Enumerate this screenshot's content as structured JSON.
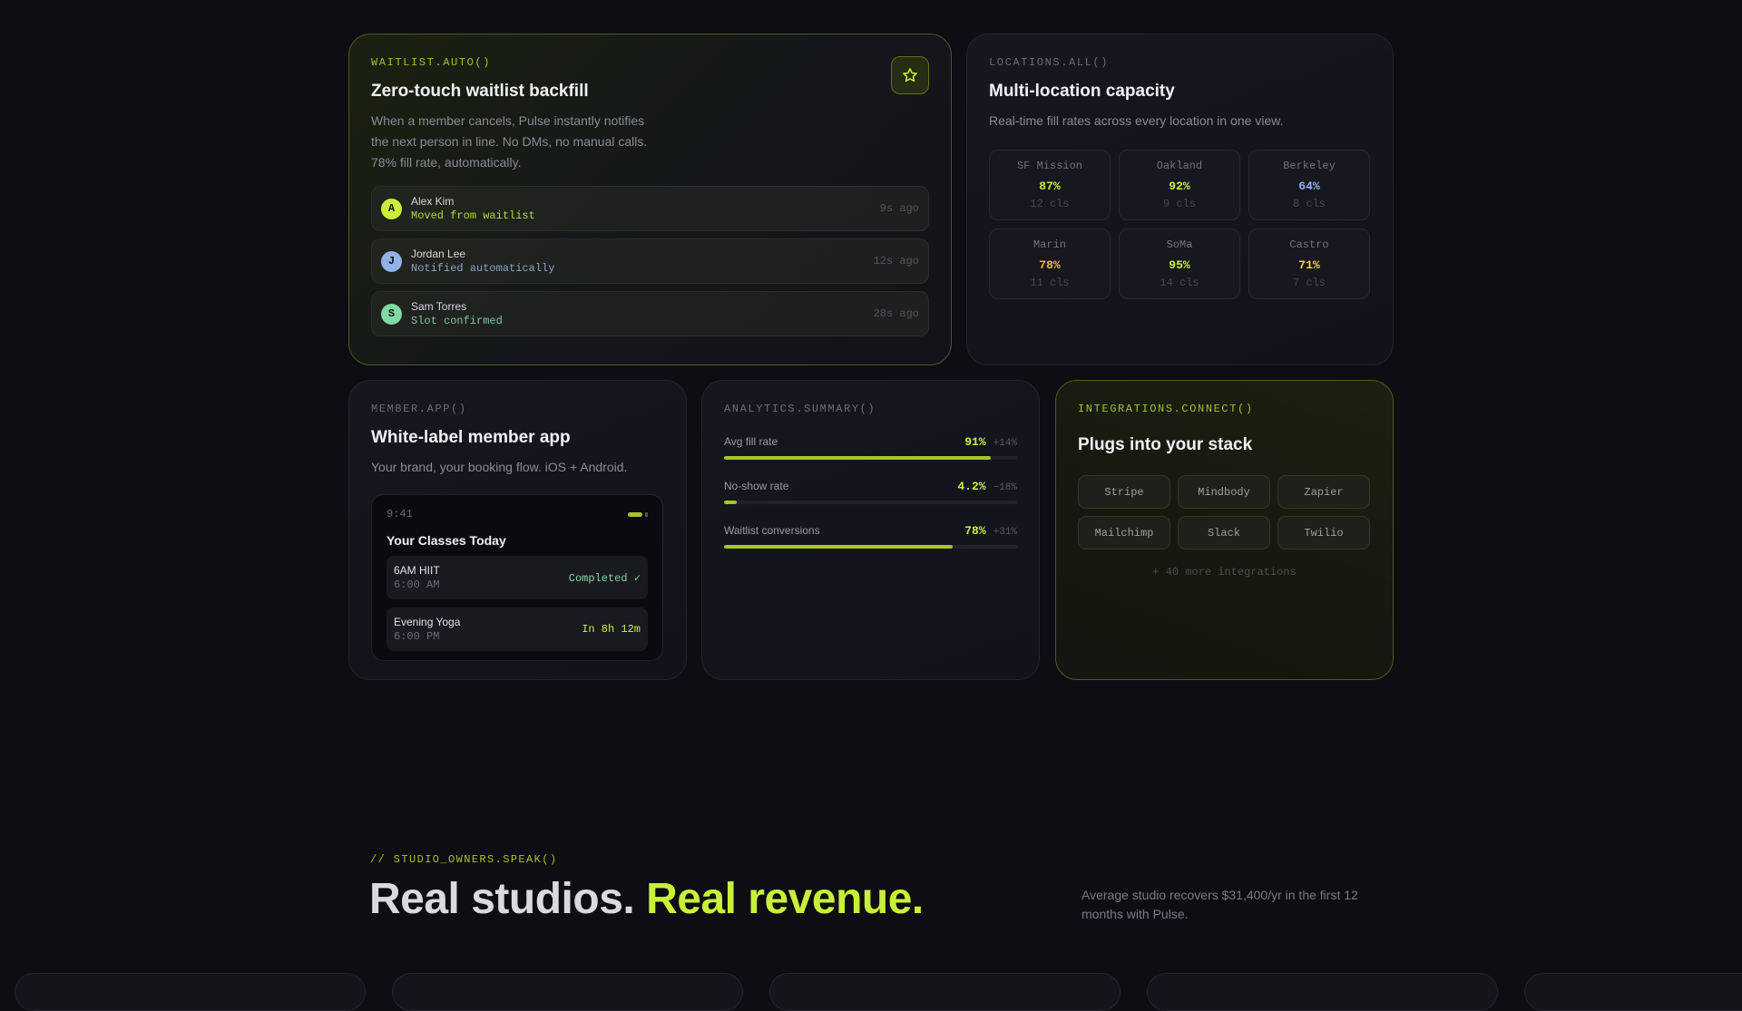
{
  "waitlist": {
    "tag": "WAITLIST.AUTO()",
    "title": "Zero-touch waitlist backfill",
    "desc": "When a member cancels, Pulse instantly notifies the next person in line. No DMs, no manual calls. 78% fill rate, automatically.",
    "star_icon": "star-icon",
    "rows": [
      {
        "initial": "A",
        "name": "Alex Kim",
        "status": "Moved from waitlist",
        "time": "9s ago",
        "avatar_color": "#c8f03a",
        "status_color": "#b5d936"
      },
      {
        "initial": "J",
        "name": "Jordan Lee",
        "status": "Notified automatically",
        "time": "12s ago",
        "avatar_color": "#8fb3e6",
        "status_color": "#8aa4c4"
      },
      {
        "initial": "S",
        "name": "Sam Torres",
        "status": "Slot confirmed",
        "time": "28s ago",
        "avatar_color": "#7fd9a3",
        "status_color": "#7fc79a"
      }
    ]
  },
  "locations": {
    "tag": "LOCATIONS.ALL()",
    "title": "Multi-location capacity",
    "desc": "Real-time fill rates across every location in one view.",
    "cells": [
      {
        "name": "SF Mission",
        "pct": "87%",
        "cls": "12 cls",
        "color": "#c8f03a"
      },
      {
        "name": "Oakland",
        "pct": "92%",
        "cls": "9 cls",
        "color": "#c8f03a"
      },
      {
        "name": "Berkeley",
        "pct": "64%",
        "cls": "8 cls",
        "color": "#8fb3f0"
      },
      {
        "name": "Marin",
        "pct": "78%",
        "cls": "11 cls",
        "color": "#f2b544"
      },
      {
        "name": "SoMa",
        "pct": "95%",
        "cls": "14 cls",
        "color": "#c8f03a"
      },
      {
        "name": "Castro",
        "pct": "71%",
        "cls": "7 cls",
        "color": "#f2d544"
      }
    ]
  },
  "member_app": {
    "tag": "MEMBER.APP()",
    "title": "White-label member app",
    "desc": "Your brand, your booking flow. iOS + Android.",
    "phone": {
      "time": "9:41",
      "title": "Your Classes Today",
      "classes": [
        {
          "name": "6AM HIIT",
          "time": "6:00 AM",
          "status": "Completed ✓",
          "status_color": "#7fd9a3"
        },
        {
          "name": "Evening Yoga",
          "time": "6:00 PM",
          "status": "In 8h 12m",
          "status_color": "#c8f03a"
        }
      ]
    }
  },
  "analytics": {
    "tag": "ANALYTICS.SUMMARY()",
    "metrics": [
      {
        "label": "Avg fill rate",
        "value": "91%",
        "delta": "+14%",
        "fill": 0.91
      },
      {
        "label": "No-show rate",
        "value": "4.2%",
        "delta": "−18%",
        "fill": 0.042
      },
      {
        "label": "Waitlist conversions",
        "value": "78%",
        "delta": "+31%",
        "fill": 0.78
      }
    ]
  },
  "integrations": {
    "tag": "INTEGRATIONS.CONNECT()",
    "title": "Plugs into your stack",
    "items": [
      "Stripe",
      "Mindbody",
      "Zapier",
      "Mailchimp",
      "Slack",
      "Twilio"
    ],
    "more": "+ 40 more integrations"
  },
  "testimonials": {
    "tag": "// STUDIO_OWNERS.SPEAK()",
    "headline_a": "Real studios.",
    "headline_b": "Real revenue.",
    "note": "Average studio recovers $31,400/yr in the first 12 months with Pulse."
  },
  "colors": {
    "accent": "#c8f03a",
    "background": "#0d0d12"
  }
}
